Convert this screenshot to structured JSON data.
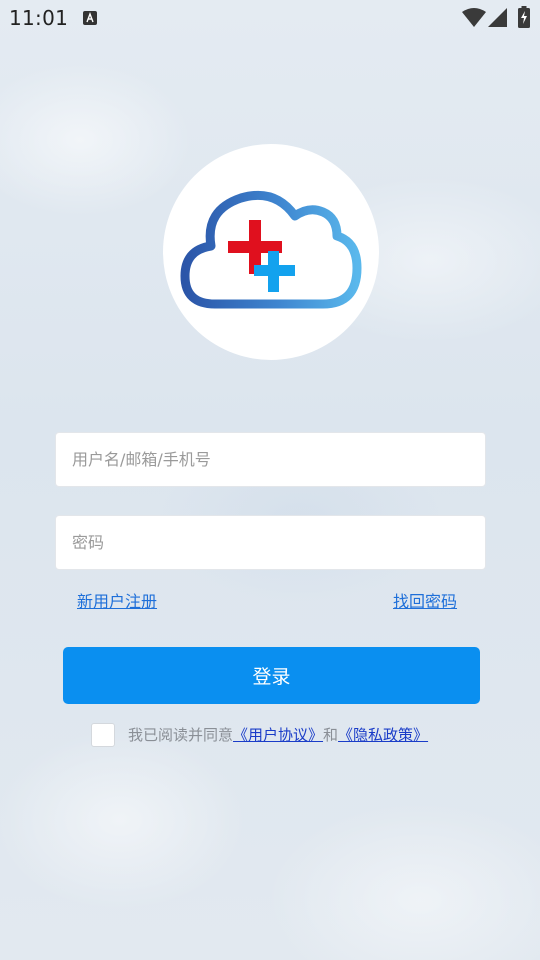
{
  "status_bar": {
    "time": "11:01",
    "icons": [
      "a-keyboard-icon",
      "wifi-icon",
      "signal-icon",
      "battery-charging-icon"
    ]
  },
  "logo": {
    "icon": "cloud-medical-cross-logo",
    "colors": {
      "cloud_start": "#2b5eb0",
      "cloud_end": "#5ab8ec",
      "red_cross": "#e0101e",
      "blue_cross": "#13a2ee"
    }
  },
  "form": {
    "username_placeholder": "用户名/邮箱/手机号",
    "password_placeholder": "密码",
    "register_link": "新用户注册",
    "forgot_link": "找回密码",
    "login_button": "登录"
  },
  "agreement": {
    "prefix": "我已阅读并同意",
    "user_agreement": "《用户协议》",
    "conjunction": "和",
    "privacy_policy": "《隐私政策》"
  },
  "colors": {
    "accent": "#0a8ff0",
    "link": "#1e6fd9",
    "agreement_link": "#1a3cc8"
  }
}
